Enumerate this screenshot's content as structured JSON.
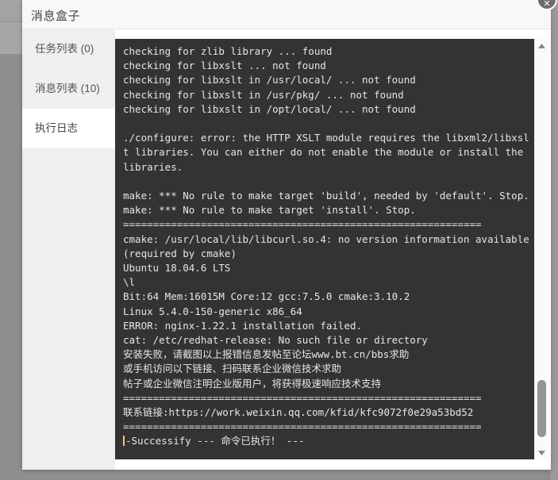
{
  "dialog": {
    "title": "消息盒子",
    "close_label": "关闭"
  },
  "icons": {
    "close": "close-icon",
    "scroll_up": "chevron-up-icon",
    "scroll_down": "chevron-down-icon"
  },
  "tabs": [
    {
      "label": "任务列表 (0)",
      "name": "tab-task-list",
      "active": false
    },
    {
      "label": "消息列表 (10)",
      "name": "tab-message-list",
      "active": false
    },
    {
      "label": "执行日志",
      "name": "tab-execution-log",
      "active": true
    }
  ],
  "console": {
    "lines": [
      "checking for zlib library ... found",
      "checking for libxslt ... not found",
      "checking for libxslt in /usr/local/ ... not found",
      "checking for libxslt in /usr/pkg/ ... not found",
      "checking for libxslt in /opt/local/ ... not found",
      "",
      "./configure: error: the HTTP XSLT module requires the libxml2/libxslt libraries. You can either do not enable the module or install the libraries.",
      "",
      "make: *** No rule to make target 'build', needed by 'default'. Stop.",
      "make: *** No rule to make target 'install'. Stop.",
      "============================================================",
      "cmake: /usr/local/lib/libcurl.so.4: no version information available (required by cmake)",
      "Ubuntu 18.04.6 LTS",
      "\\l",
      "Bit:64 Mem:16015M Core:12 gcc:7.5.0 cmake:3.10.2",
      "Linux 5.4.0-150-generic x86_64",
      "ERROR: nginx-1.22.1 installation failed.",
      "cat: /etc/redhat-release: No such file or directory",
      "安装失败，请截图以上报错信息发帖至论坛www.bt.cn/bbs求助",
      "或手机访问以下链接、扫码联系企业微信技术求助",
      "帖子或企业微信注明企业版用户，将获得极速响应技术支持",
      "============================================================",
      "联系链接:https://work.weixin.qq.com/kfid/kfc9072f0e29a53bd52",
      "============================================================"
    ],
    "final_line": "-Successify --- 命令已执行！ ---"
  },
  "colors": {
    "console_bg": "#333333",
    "console_text": "#e6e6e6",
    "cursor": "#f0c674",
    "dialog_bg": "#ffffff",
    "tab_rail_bg": "#efefef",
    "backdrop": "#8f8f8f"
  }
}
